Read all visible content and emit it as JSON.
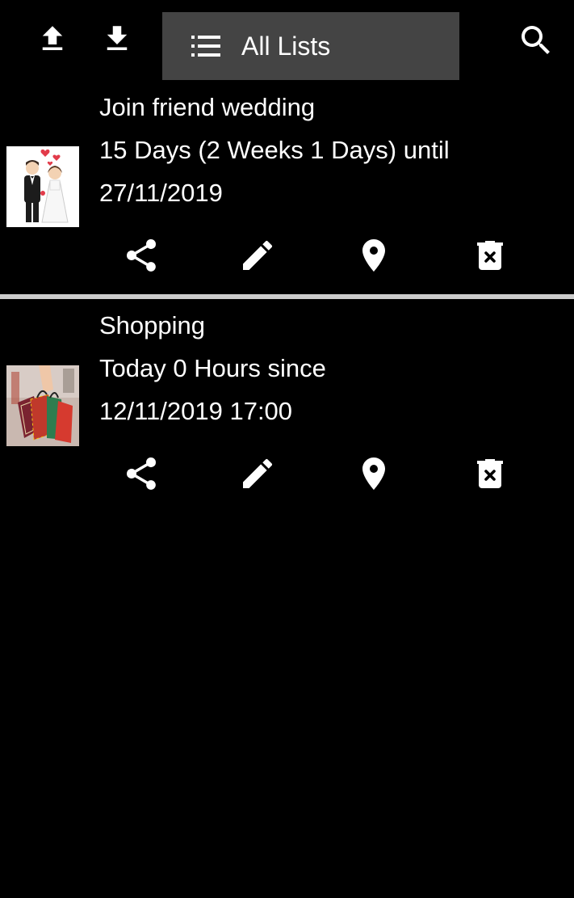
{
  "toolbar": {
    "upload_icon": "upload-icon",
    "download_icon": "download-icon",
    "list_selector_label": "All Lists",
    "list_icon": "list-icon",
    "search_icon": "search-icon"
  },
  "items": [
    {
      "title": "Join friend wedding",
      "line2": "15 Days (2 Weeks 1  Days)  until",
      "line3": "27/11/2019",
      "thumbnail": "wedding-couple-image",
      "actions": [
        "share-icon",
        "edit-icon",
        "location-icon",
        "delete-icon"
      ]
    },
    {
      "title": "Shopping",
      "line2": "Today  0 Hours since",
      "line3": "12/11/2019 17:00",
      "thumbnail": "shopping-bags-image",
      "actions": [
        "share-icon",
        "edit-icon",
        "location-icon",
        "delete-icon"
      ]
    }
  ],
  "colors": {
    "background": "#000000",
    "selector_bg": "#444444",
    "divider": "#cccccc",
    "text": "#ffffff"
  }
}
